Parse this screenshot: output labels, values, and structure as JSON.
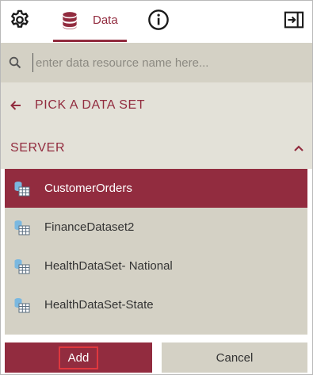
{
  "header": {
    "tabs": [
      {
        "icon": "gear-icon"
      },
      {
        "icon": "database-icon",
        "label": "Data",
        "active": true
      },
      {
        "icon": "info-icon"
      }
    ],
    "collapse_icon": "collapse-panel-icon"
  },
  "search": {
    "icon": "search-icon",
    "placeholder": "enter data resource name here...",
    "value": ""
  },
  "nav": {
    "back_icon": "arrow-left-icon",
    "title": "PICK A DATA SET"
  },
  "section": {
    "title": "SERVER",
    "expanded": true,
    "chevron_icon": "chevron-up-icon"
  },
  "datasets": [
    {
      "label": "CustomerOrders",
      "selected": true
    },
    {
      "label": "FinanceDataset2",
      "selected": false
    },
    {
      "label": "HealthDataSet- National",
      "selected": false
    },
    {
      "label": "HealthDataSet-State",
      "selected": false
    }
  ],
  "footer": {
    "add_label": "Add",
    "cancel_label": "Cancel"
  },
  "colors": {
    "accent": "#922c3f",
    "panel": "#d4d1c5",
    "panel_light": "#e3e1d8",
    "highlight_border": "#e0383e"
  }
}
